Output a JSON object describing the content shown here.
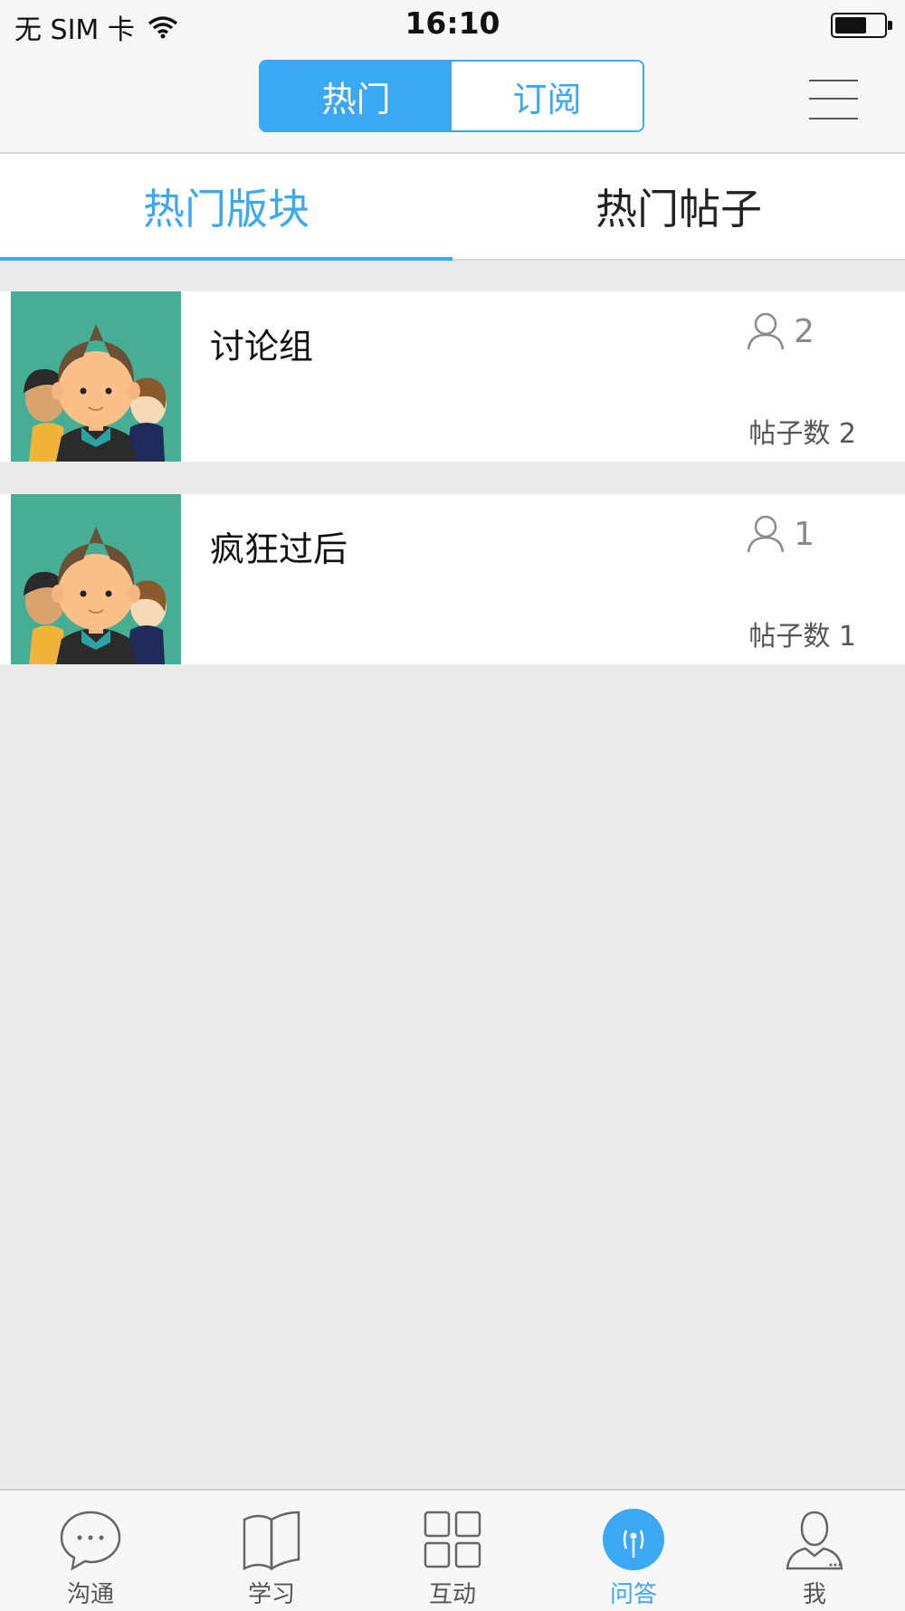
{
  "status": {
    "carrier": "无 SIM 卡",
    "time": "16:10"
  },
  "segmented": {
    "hot": "热门",
    "subscribe": "订阅"
  },
  "subtabs": {
    "boards": "热门版块",
    "posts": "热门帖子"
  },
  "boards": [
    {
      "name": "讨论组",
      "members": "2",
      "posts_label": "帖子数 2"
    },
    {
      "name": "疯狂过后",
      "members": "1",
      "posts_label": "帖子数 1"
    }
  ],
  "tabbar": [
    {
      "label": "沟通",
      "icon": "chat-bubble-icon"
    },
    {
      "label": "学习",
      "icon": "book-icon"
    },
    {
      "label": "互动",
      "icon": "grid-icon"
    },
    {
      "label": "问答",
      "icon": "qa-icon"
    },
    {
      "label": "我",
      "icon": "person-icon"
    }
  ],
  "colors": {
    "accent": "#3aa8f5",
    "background": "#ebebeb",
    "avatar_bg": "#45ae94"
  }
}
